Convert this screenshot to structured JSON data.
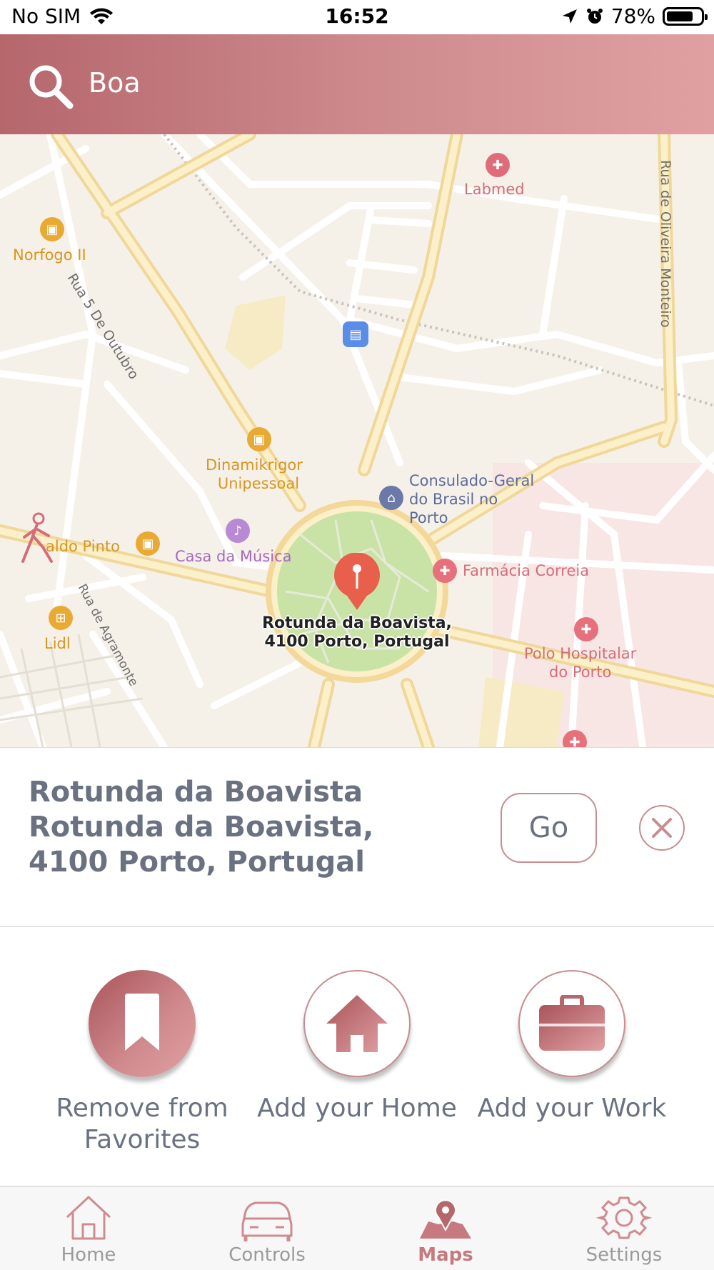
{
  "status_bar": {
    "carrier": "No SIM",
    "time": "16:52",
    "battery": "78%",
    "battery_level": 0.78
  },
  "search": {
    "value": "Boa",
    "icon": "search-icon"
  },
  "map": {
    "pin_label_line1": "Rotunda da Boavista,",
    "pin_label_line2": "4100 Porto, Portugal",
    "places": {
      "labmed": "Labmed",
      "norfogo": "Norfogo II",
      "dinamikrigor_1": "Dinamikrigor",
      "dinamikrigor_2": "Unipessoal",
      "consulado_1": "Consulado-Geral",
      "consulado_2": "do Brasil no",
      "consulado_3": "Porto",
      "aldo_pinto": "aldo Pinto",
      "casa_musica": "Casa da Música",
      "farmacia": "Farmácia Correia",
      "polo_1": "Polo Hospitalar",
      "polo_2": "do Porto",
      "lidl": "Lidl"
    },
    "streets": {
      "rua_5_outubro": "Rua 5 De Outubro",
      "rua_oliveira": "Rua de Oliveira Monteiro",
      "rua_agramonte": "Rua de Agramonte"
    }
  },
  "info_card": {
    "title": "Rotunda da Boavista",
    "address": "Rotunda da Boavista, 4100 Porto, Portugal",
    "go_label": "Go"
  },
  "shortcuts": [
    {
      "label": "Remove from Favorites",
      "icon": "bookmark-icon"
    },
    {
      "label": "Add your Home",
      "icon": "house-icon"
    },
    {
      "label": "Add your Work",
      "icon": "briefcase-icon"
    }
  ],
  "tabs": [
    {
      "label": "Home",
      "icon": "home-icon"
    },
    {
      "label": "Controls",
      "icon": "car-icon"
    },
    {
      "label": "Maps",
      "icon": "map-pin-icon",
      "active": true
    },
    {
      "label": "Settings",
      "icon": "gear-icon"
    }
  ],
  "colors": {
    "accent": "#c67a80",
    "accent_dark": "#a9545a",
    "text": "#6a7282",
    "pin": "#e8604c"
  }
}
